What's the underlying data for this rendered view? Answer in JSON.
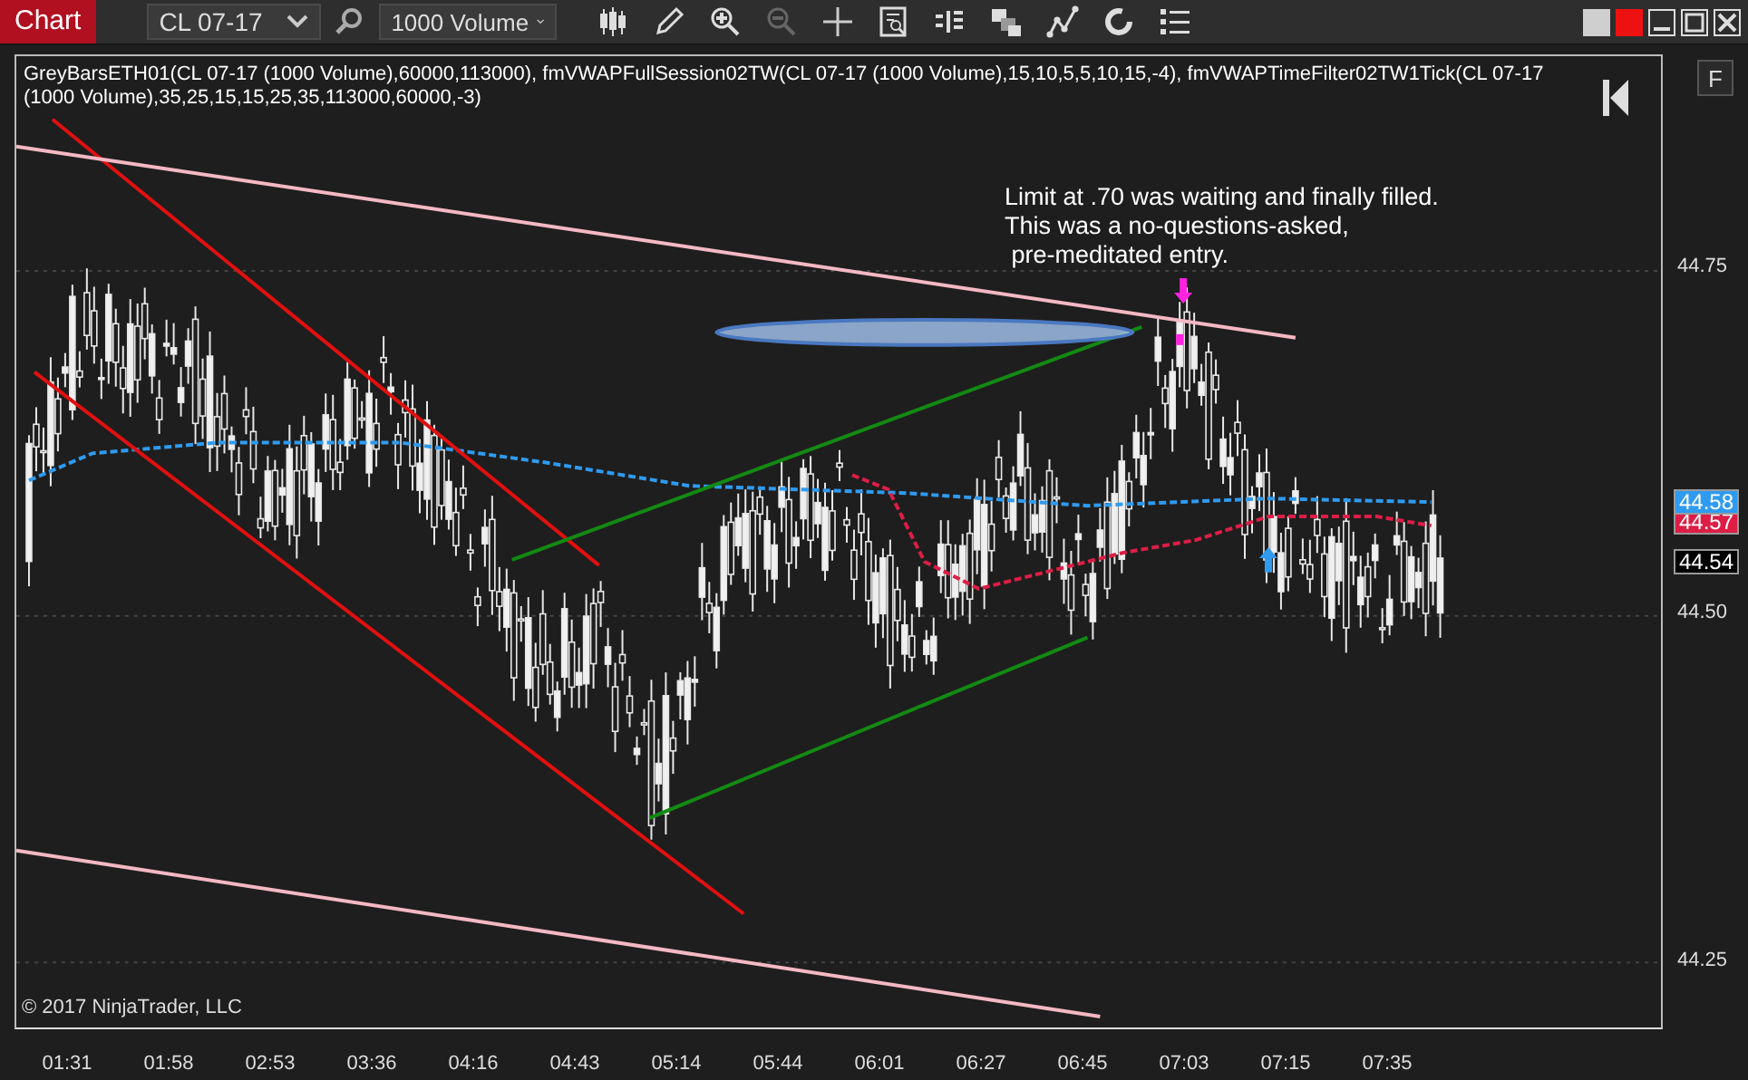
{
  "window": {
    "title": "Chart"
  },
  "toolbar": {
    "instrument": "CL 07-17",
    "interval": "1000 Volume"
  },
  "chart": {
    "indicators": "GreyBarsETH01(CL 07-17 (1000 Volume),60000,113000), fmVWAPFullSession02TW(CL 07-17 (1000 Volume),15,10,5,5,10,15,-4), fmVWAPTimeFilter02TW1Tick(CL 07-17 (1000 Volume),35,25,15,15,25,35,113000,60000,-3)",
    "note": "Limit at .70 was waiting and finally filled.\nThis was a no-questions-asked,\n pre-meditated entry.",
    "copyright": "© 2017 NinjaTrader, LLC",
    "panel_button": "F",
    "y_ticks": [
      "44.75",
      "44.50",
      "44.25"
    ],
    "price_flags": [
      {
        "label": "44.58",
        "color": "#2f9bf0"
      },
      {
        "label": "44.57",
        "color": "#dc1e46"
      },
      {
        "label": "44.54",
        "color": "#000000"
      }
    ],
    "x_ticks": [
      "01:31",
      "01:58",
      "02:53",
      "03:36",
      "04:16",
      "04:43",
      "05:14",
      "05:44",
      "06:01",
      "06:27",
      "06:45",
      "07:03",
      "07:15",
      "07:35"
    ]
  }
}
